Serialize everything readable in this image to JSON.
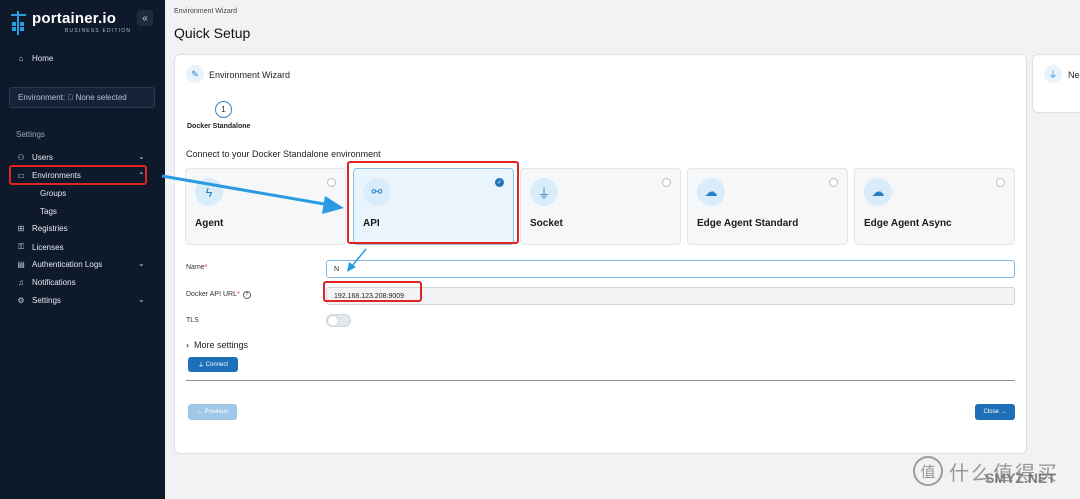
{
  "sidebar": {
    "logo_name": "portainer.io",
    "logo_sub": "BUSINESS EDITION",
    "collapse": "«",
    "home": "Home",
    "environment": "Environment: ⃠ None selected",
    "settings_section": "Settings",
    "items": {
      "users": "Users",
      "environments": "Environments",
      "groups": "Groups",
      "tags": "Tags",
      "registries": "Registries",
      "licenses": "Licenses",
      "auth_logs": "Authentication Logs",
      "notifications": "Notifications",
      "settings": "Settings"
    }
  },
  "breadcrumb": "Environment Wizard",
  "page_title": "Quick Setup",
  "wizard": {
    "title": "Environment Wizard",
    "side_title": "Ne",
    "step_number": "1",
    "step_label": "Docker Standalone",
    "heading": "Connect to your Docker Standalone environment",
    "options": [
      {
        "label": "Agent",
        "selected": false
      },
      {
        "label": "API",
        "selected": true
      },
      {
        "label": "Socket",
        "selected": false
      },
      {
        "label": "Edge Agent Standard",
        "selected": false
      },
      {
        "label": "Edge Agent Async",
        "selected": false
      }
    ],
    "name_label": "Name",
    "name_value": "N",
    "url_label": "Docker API URL",
    "url_value": "192.168.123.208:9009",
    "tls_label": "TLS",
    "tls_on": false,
    "more_settings": "More settings",
    "connect_button": "Connect",
    "previous_button": "← Previous",
    "close_button": "Close →"
  },
  "watermark": {
    "logo": "值",
    "text": "什么值得买",
    "sub": "SMYZ.NET"
  },
  "colors": {
    "sidebar_bg": "#0e1a2b",
    "primary": "#1d70b8",
    "annotation": "#e02424",
    "arrow": "#2a9be0"
  }
}
